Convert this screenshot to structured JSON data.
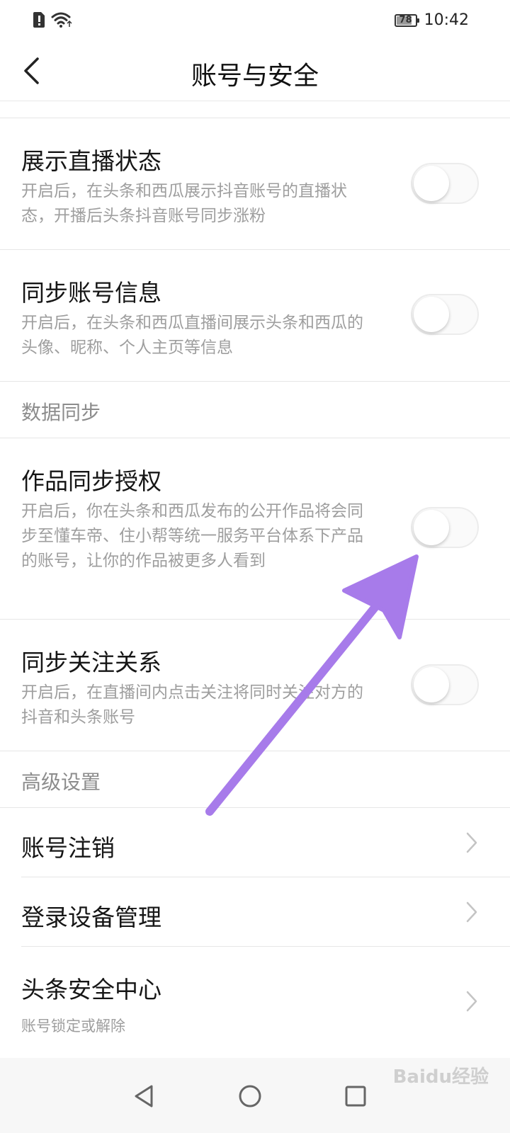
{
  "status_bar": {
    "battery": "78",
    "time": "10:42"
  },
  "header": {
    "title": "账号与安全"
  },
  "settings": [
    {
      "title": "展示直播状态",
      "desc": "开启后，在头条和西瓜展示抖音账号的直播状态，开播后头条抖音账号同步涨粉",
      "enabled": false
    },
    {
      "title": "同步账号信息",
      "desc": "开启后，在头条和西瓜直播间展示头条和西瓜的头像、昵称、个人主页等信息",
      "enabled": false
    }
  ],
  "section_data_sync": "数据同步",
  "sync_settings": [
    {
      "title": "作品同步授权",
      "desc": "开启后，你在头条和西瓜发布的公开作品将会同步至懂车帝、住小帮等统一服务平台体系下产品的账号，让你的作品被更多人看到",
      "enabled": false
    },
    {
      "title": "同步关注关系",
      "desc": "开启后，在直播间内点击关注将同时关注对方的抖音和头条账号",
      "enabled": false
    }
  ],
  "section_advanced": "高级设置",
  "advanced_items": [
    {
      "title": "账号注销"
    },
    {
      "title": "登录设备管理"
    },
    {
      "title": "头条安全中心",
      "desc": "账号锁定或解除"
    }
  ],
  "watermark": "Baidu经验",
  "colors": {
    "arrow": "#a77bea",
    "toggle_off_track": "#fafafa",
    "secondary_text": "#9e9e9e"
  }
}
